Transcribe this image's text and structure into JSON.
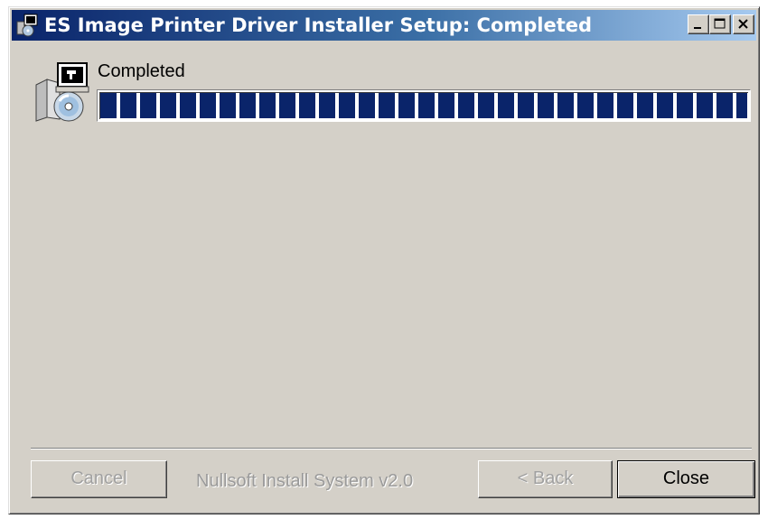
{
  "window": {
    "title": "ES Image Printer Driver Installer Setup: Completed",
    "icon": "installer-icon"
  },
  "caption_buttons": {
    "minimize": "minimize-icon",
    "maximize": "maximize-icon",
    "close": "close-icon"
  },
  "header": {
    "icon": "installer-cd-icon",
    "status_text": "Completed"
  },
  "progress": {
    "value_percent": 100,
    "color": "#0a246a"
  },
  "footer": {
    "cancel_label": "Cancel",
    "branding": "Nullsoft Install System v2.0",
    "back_label": "< Back",
    "close_label": "Close"
  },
  "colors": {
    "dialog_bg": "#d4d0c8",
    "titlebar_start": "#0a246a",
    "titlebar_end": "#a6caf0"
  }
}
